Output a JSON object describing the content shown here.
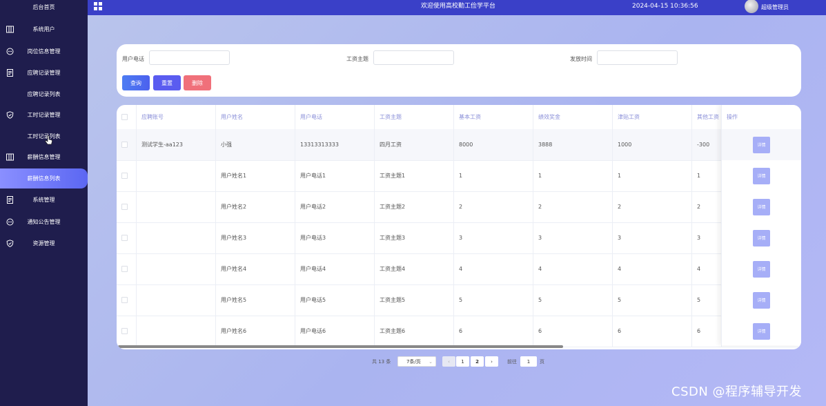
{
  "sidebar": {
    "items": [
      {
        "label": "后台首页",
        "icon": "home-icon"
      },
      {
        "label": "系统用户",
        "icon": "columns-icon"
      },
      {
        "label": "岗位信息管理",
        "icon": "chat-icon"
      },
      {
        "label": "应聘记录管理",
        "icon": "document-icon"
      },
      {
        "label": "应聘记录列表",
        "icon": ""
      },
      {
        "label": "工时记录管理",
        "icon": "shield-icon"
      },
      {
        "label": "工时记录列表",
        "icon": ""
      },
      {
        "label": "薪酬信息管理",
        "icon": "columns-icon"
      },
      {
        "label": "薪酬信息列表",
        "icon": ""
      },
      {
        "label": "系统管理",
        "icon": "document-icon"
      },
      {
        "label": "通知公告管理",
        "icon": "chat-icon"
      },
      {
        "label": "资源管理",
        "icon": "shield-icon"
      }
    ]
  },
  "header": {
    "title": "欢迎使用高校勤工俭学平台",
    "datetime": "2024-04-15 10:36:56",
    "user": "超级管理员"
  },
  "search": {
    "phone_label": "用户电话",
    "topic_label": "工资主题",
    "date_label": "发放时间",
    "query_button": "查询",
    "reset_button": "重置",
    "delete_button": "删除"
  },
  "table": {
    "columns": [
      "应聘账号",
      "用户姓名",
      "用户电话",
      "工资主题",
      "基本工资",
      "绩效奖金",
      "津贴工资",
      "其他工资",
      "操作"
    ],
    "detail_label": "详情",
    "rows": [
      [
        "测试学生-aa123",
        "小强",
        "13313313333",
        "四月工资",
        "8000",
        "3888",
        "1000",
        "-300"
      ],
      [
        "",
        "用户姓名1",
        "用户电话1",
        "工资主题1",
        "1",
        "1",
        "1",
        "1"
      ],
      [
        "",
        "用户姓名2",
        "用户电话2",
        "工资主题2",
        "2",
        "2",
        "2",
        "2"
      ],
      [
        "",
        "用户姓名3",
        "用户电话3",
        "工资主题3",
        "3",
        "3",
        "3",
        "3"
      ],
      [
        "",
        "用户姓名4",
        "用户电话4",
        "工资主题4",
        "4",
        "4",
        "4",
        "4"
      ],
      [
        "",
        "用户姓名5",
        "用户电话5",
        "工资主题5",
        "5",
        "5",
        "5",
        "5"
      ],
      [
        "",
        "用户姓名6",
        "用户电话6",
        "工资主题6",
        "6",
        "6",
        "6",
        "6"
      ]
    ]
  },
  "pagination": {
    "total": "共 13 条",
    "page_size": "7条/页",
    "pages": [
      "1",
      "2"
    ],
    "current_page": "2",
    "goto_prefix": "前往",
    "goto_value": "1",
    "goto_suffix": "页"
  },
  "watermark": "CSDN @程序辅导开发",
  "colors": {
    "sidebar_bg": "#1f1d4d",
    "topbar_bg": "#3a40c8",
    "query_button": "#4c70f0",
    "reset_button": "#5a5cf0",
    "delete_button": "#f0707a",
    "detail_button": "#a6aef7"
  }
}
